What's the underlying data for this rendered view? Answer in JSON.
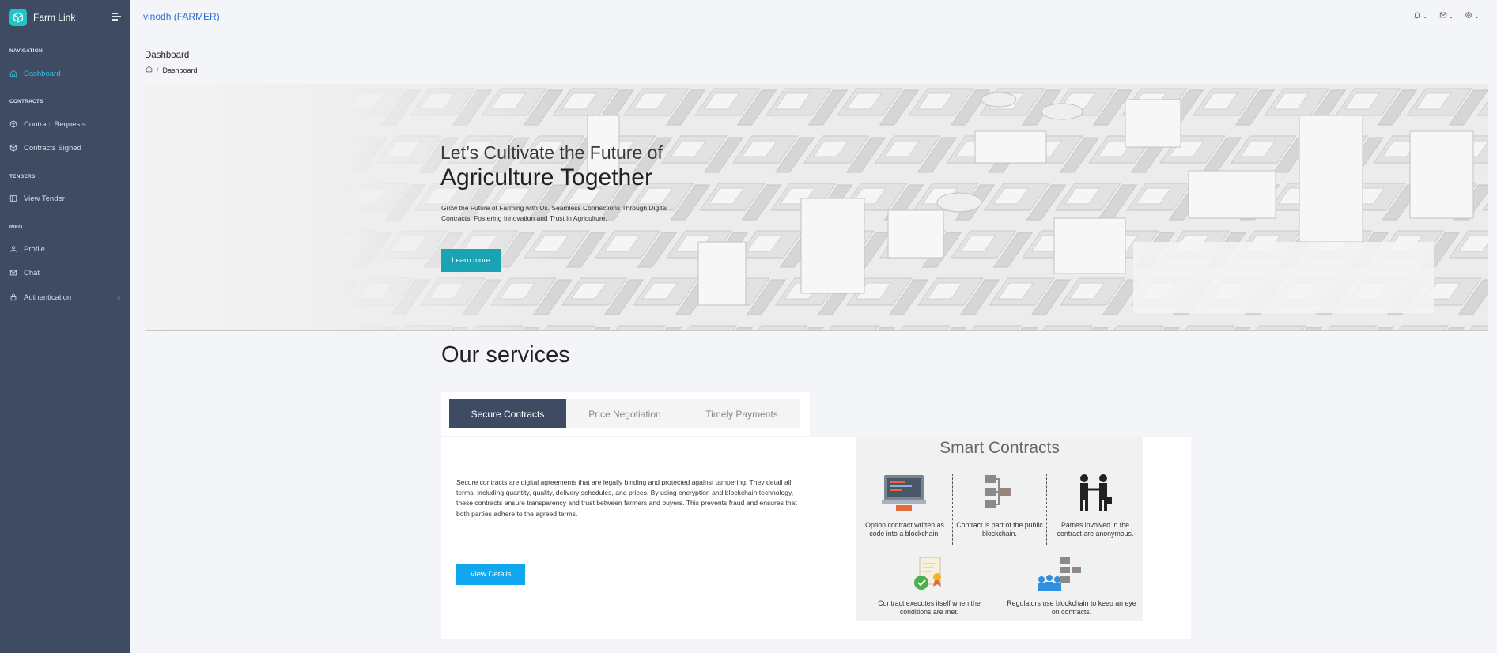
{
  "app": {
    "name": "Farm Link"
  },
  "sidebar": {
    "sections": [
      {
        "caption": "NAVIGATION",
        "items": [
          {
            "label": "Dashboard",
            "icon": "home-icon",
            "active": true
          }
        ]
      },
      {
        "caption": "CONTRACTS",
        "items": [
          {
            "label": "Contract Requests",
            "icon": "package-icon"
          },
          {
            "label": "Contracts Signed",
            "icon": "package-icon"
          }
        ]
      },
      {
        "caption": "TENDERS",
        "items": [
          {
            "label": "View Tender",
            "icon": "columns-icon"
          }
        ]
      },
      {
        "caption": "INFO",
        "items": [
          {
            "label": "Profile",
            "icon": "user-icon"
          },
          {
            "label": "Chat",
            "icon": "mail-icon"
          },
          {
            "label": "Authentication",
            "icon": "lock-icon"
          }
        ]
      }
    ]
  },
  "topbar": {
    "user": "vinodh (FARMER)",
    "icons": [
      "bell-icon",
      "mail-icon",
      "settings-icon"
    ]
  },
  "page": {
    "title": "Dashboard",
    "breadcrumb": [
      "home-icon",
      "Dashboard"
    ]
  },
  "hero": {
    "subtitle": "Let’s Cultivate the Future of",
    "title": "Agriculture Together",
    "description": "Grow the Future of Farming with Us. Seamless Connections Through Digital Contracts. Fostering Innovation and Trust in Agriculture.",
    "button": "Learn more"
  },
  "services": {
    "title": "Our services",
    "tabs": [
      {
        "label": "Secure Contracts",
        "active": true
      },
      {
        "label": "Price Negotiation"
      },
      {
        "label": "Timely Payments"
      }
    ],
    "body": "Secure contracts are digital agreements that are legally binding and protected against tampering. They detail all terms, including quantity, quality, delivery schedules, and prices. By using encryption and blockchain technology, these contracts ensure transparency and trust between farmers and buyers. This prevents fraud and ensures that both parties adhere to the agreed terms.",
    "button": "View Details"
  },
  "infographic": {
    "title": "Smart Contracts",
    "captions": [
      "Option contract written as code into a blockchain.",
      "Contract is part of the public blockchain.",
      "Parties involved in the contract are anonymous.",
      "Contract executes itself when the conditions are met.",
      "Regulators use blockchain to keep an eye on contracts."
    ]
  },
  "colors": {
    "sidebar": "#3e4b63",
    "accent": "#35c1e8",
    "learn_button": "#1aa3b5",
    "view_button": "#10a7ee",
    "user_link": "#2f6fd0"
  }
}
